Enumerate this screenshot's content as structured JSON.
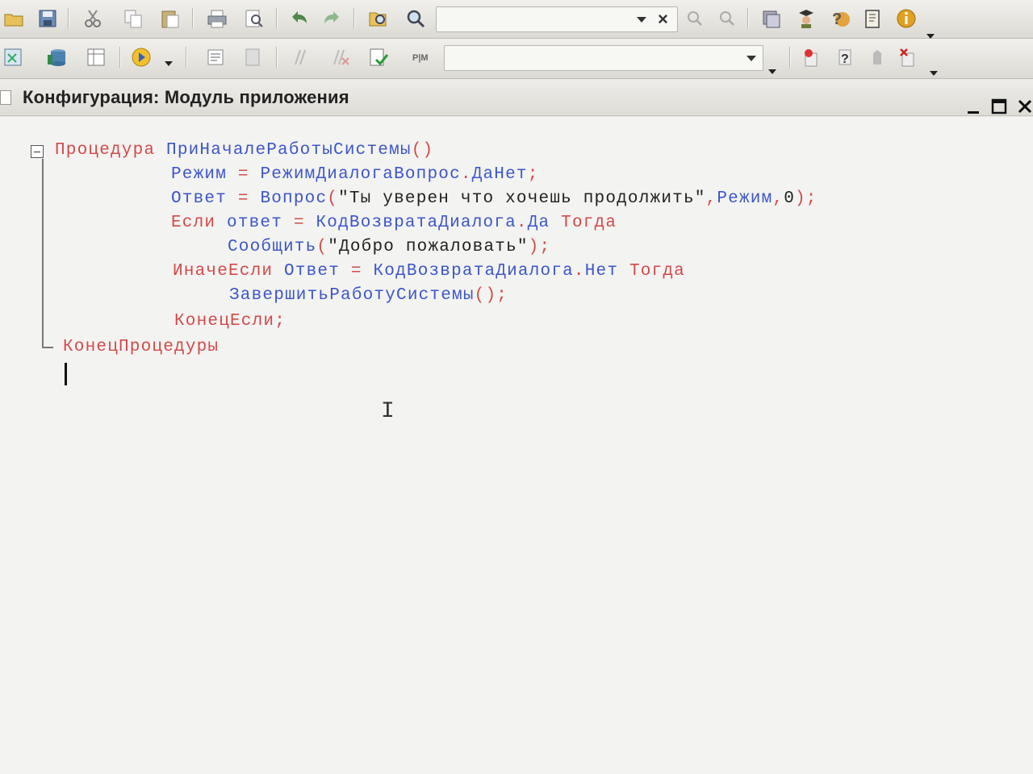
{
  "toolbar1": {
    "search_value": "",
    "icons": [
      "open-icon",
      "save-icon",
      "cut-icon",
      "copy-icon",
      "paste-icon",
      "print-icon",
      "print-preview-icon",
      "undo-icon",
      "redo-icon",
      "find-in-tree-icon",
      "find-icon",
      "prev-search-icon",
      "next-search-icon",
      "window-icon",
      "wizard-icon",
      "help-icon",
      "book-icon",
      "info-icon"
    ]
  },
  "toolbar2": {
    "combo_value": "",
    "icons": [
      "compare-icon",
      "database-icon",
      "table-icon",
      "run-icon",
      "module-icon",
      "syntax-icon",
      "comment-icon",
      "uncomment-icon",
      "check-icon",
      "sort-icon",
      "breakpoint-icon",
      "debug-help-icon",
      "stop-icon",
      "clear-breakpoints-icon"
    ]
  },
  "window": {
    "title": "Конфигурация: Модуль приложения"
  },
  "code": {
    "line1": {
      "kw": "Процедура",
      "name": "ПриНачалеРаботыСистемы",
      "paren": "()"
    },
    "line2": {
      "var": "Режим",
      "eq": "=",
      "val": "РежимДиалогаВопрос",
      "dot": ".",
      "member": "ДаНет",
      "semi": ";"
    },
    "line3": {
      "var": "Ответ",
      "eq": "=",
      "fn": "Вопрос",
      "open": "(",
      "str": "\"Ты уверен что хочешь продолжить\"",
      "comma1": ",",
      "arg2": "Режим",
      "comma2": ",",
      "arg3": "0",
      "close": ");"
    },
    "line4": {
      "kw": "Если",
      "var": "ответ",
      "eq": "=",
      "val": "КодВозвратаДиалога",
      "dot": ".",
      "member": "Да",
      "kw2": "Тогда"
    },
    "line5": {
      "fn": "Сообщить",
      "open": "(",
      "str": "\"Добро пожаловать\"",
      "close": ");"
    },
    "line6": {
      "kw": "ИначеЕсли",
      "var": "Ответ",
      "eq": "=",
      "val": "КодВозвратаДиалога",
      "dot": ".",
      "member": "Нет",
      "kw2": "Тогда"
    },
    "line7": {
      "fn": "ЗавершитьРаботуСистемы",
      "paren": "();"
    },
    "line8": {
      "kw": "КонецЕсли",
      "semi": ";"
    },
    "line9": {
      "kw": "КонецПроцедуры"
    }
  },
  "colors": {
    "keyword": "#d24a4a",
    "identifier": "#3d56c8",
    "string": "#222222"
  }
}
